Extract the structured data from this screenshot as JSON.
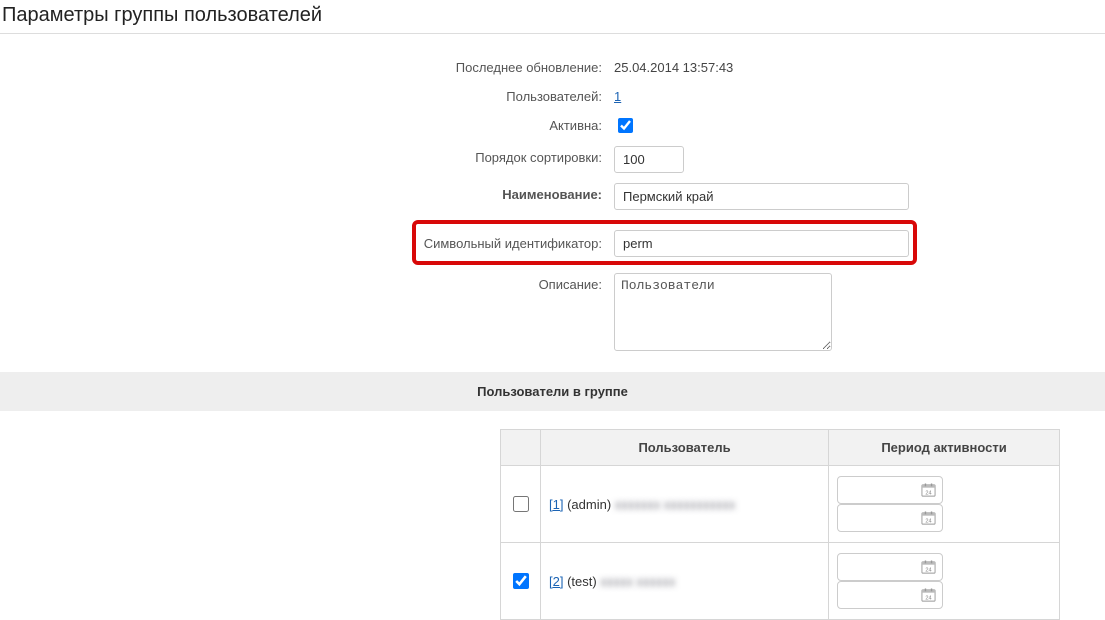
{
  "page": {
    "title": "Параметры группы пользователей"
  },
  "form": {
    "last_update_label": "Последнее обновление:",
    "last_update_value": "25.04.2014 13:57:43",
    "users_count_label": "Пользователей:",
    "users_count_value": "1",
    "active_label": "Активна:",
    "active_checked": true,
    "sort_order_label": "Порядок сортировки:",
    "sort_order_value": "100",
    "name_label": "Наименование:",
    "name_value": "Пермский край",
    "symbol_id_label": "Символьный идентификатор:",
    "symbol_id_value": "perm",
    "description_label": "Описание:",
    "description_value": "Пользователи "
  },
  "section": {
    "users_header": "Пользователи в группе"
  },
  "users_table": {
    "col_user": "Пользователь",
    "col_period": "Период активности",
    "rows": [
      {
        "checked": false,
        "id_link": "[1]",
        "login": "(admin)",
        "name_obscured": "———"
      },
      {
        "checked": true,
        "id_link": "[2]",
        "login": "(test)",
        "name_obscured": "———"
      }
    ]
  }
}
